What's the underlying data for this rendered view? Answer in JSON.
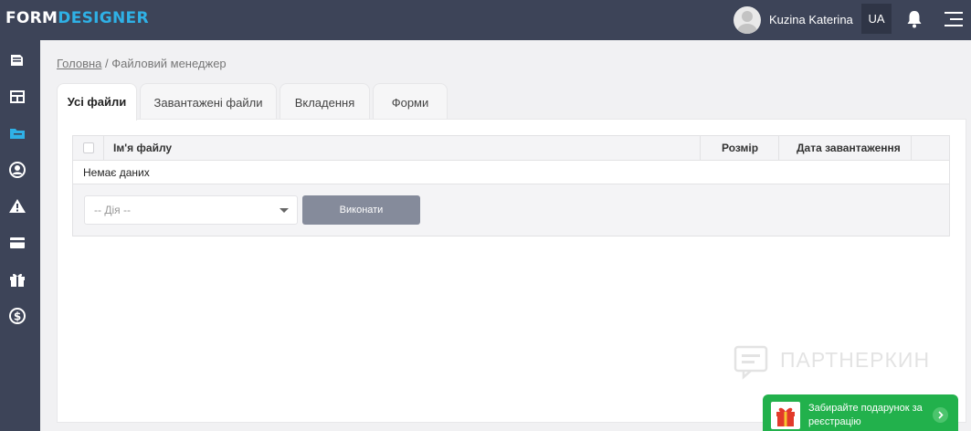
{
  "header": {
    "logo_part1": "FORM",
    "logo_part2": "DESIGNER",
    "user_name": "Kuzina Katerina",
    "language": "UA",
    "bell_icon": "bell-icon",
    "menu_icon": "hamburger-menu-icon"
  },
  "sidebar": {
    "items": [
      {
        "icon": "file-icon",
        "active": false
      },
      {
        "icon": "layout-icon",
        "active": false
      },
      {
        "icon": "folder-icon",
        "active": true
      },
      {
        "icon": "user-circle-icon",
        "active": false
      },
      {
        "icon": "warning-icon",
        "active": false
      },
      {
        "icon": "credit-card-icon",
        "active": false
      },
      {
        "icon": "gift-icon",
        "active": false
      },
      {
        "icon": "dollar-icon",
        "active": false
      }
    ]
  },
  "breadcrumb": {
    "home": "Головна",
    "separator": " / ",
    "current": "Файловий менеджер"
  },
  "tabs": [
    {
      "label": "Усі файли",
      "active": true
    },
    {
      "label": "Завантажені файли",
      "active": false
    },
    {
      "label": "Вкладення",
      "active": false
    },
    {
      "label": "Форми",
      "active": false
    }
  ],
  "table": {
    "columns": [
      "Ім'я файлу",
      "Розмір",
      "Дата завантаження"
    ],
    "empty_text": "Немає даних"
  },
  "actions": {
    "select_value": "-- Дія --",
    "execute_label": "Виконати"
  },
  "watermark": {
    "text": "ПАРТНЕРКИН"
  },
  "promo": {
    "text": "Забирайте подарунок за реєстрацію"
  },
  "colors": {
    "topbar": "#3d4458",
    "accent": "#2fb1e6",
    "button": "#858b9b",
    "promo": "#22b14c"
  }
}
